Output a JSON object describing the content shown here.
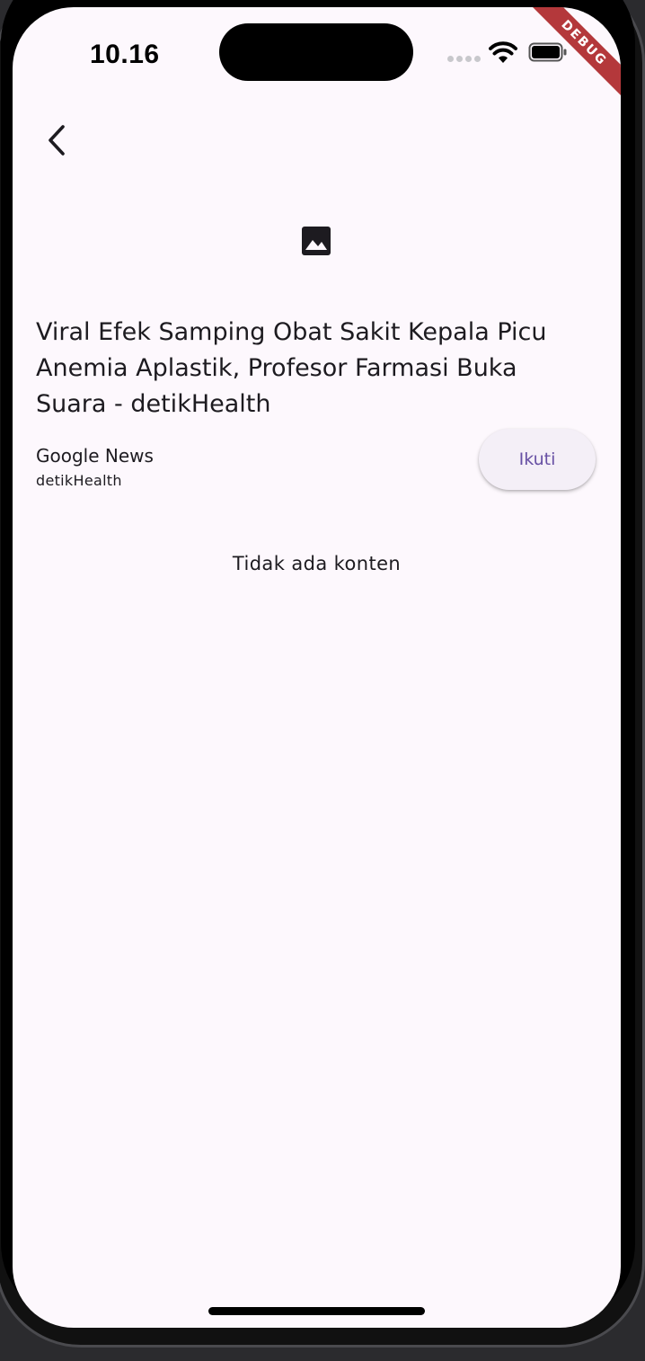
{
  "status_bar": {
    "time": "10.16",
    "icons": [
      "cellular-signal-icon",
      "wifi-icon",
      "battery-icon"
    ]
  },
  "debug_banner": "DEBUG",
  "nav": {
    "back_icon": "chevron-left-icon"
  },
  "article": {
    "image_icon": "image-placeholder-icon",
    "title": "Viral Efek Samping Obat Sakit Kepala Picu Anemia Aplastik, Profesor Farmasi Buka Suara - detikHealth",
    "source": "Google News",
    "publisher": "detikHealth",
    "follow_label": "Ikuti"
  },
  "content": {
    "empty_message": "Tidak ada konten"
  },
  "colors": {
    "background": "#fdf8fd",
    "text": "#1d1b20",
    "accent": "#6750a4",
    "button_bg": "#f4eff7",
    "debug_ribbon": "#b4383b"
  }
}
